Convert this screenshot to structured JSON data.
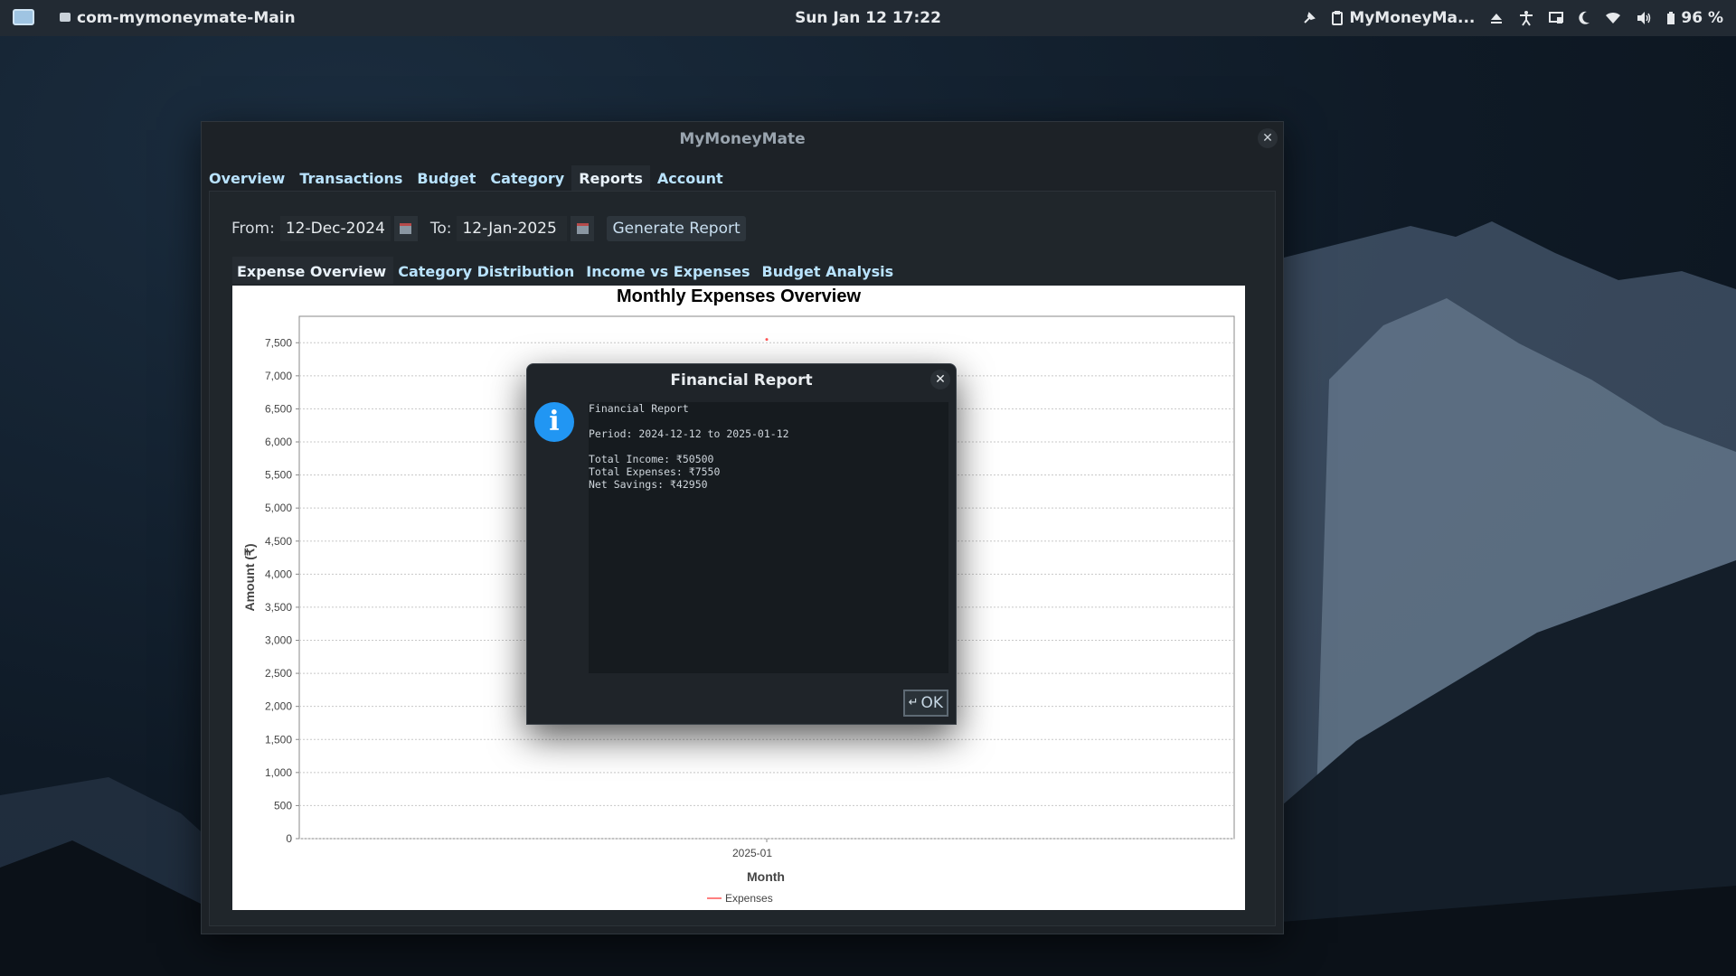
{
  "topbar": {
    "app_name": "com-mymoneymate-Main",
    "clock": "Sun Jan 12  17:22",
    "task_title": "MyMoneyMa...",
    "battery": "96 %"
  },
  "window": {
    "title": "MyMoneyMate",
    "close_glyph": "✕",
    "tabs": [
      "Overview",
      "Transactions",
      "Budget",
      "Category",
      "Reports",
      "Account"
    ],
    "active_tab": "Reports"
  },
  "report": {
    "from_label": "From:",
    "from_value": "12-Dec-2024",
    "to_label": "To:",
    "to_value": "12-Jan-2025",
    "generate_label": "Generate Report",
    "sub_tabs": [
      "Expense Overview",
      "Category Distribution",
      "Income vs Expenses",
      "Budget Analysis"
    ],
    "active_sub_tab": "Expense Overview"
  },
  "chart_data": {
    "type": "line",
    "title": "Monthly Expenses Overview",
    "xlabel": "Month",
    "ylabel": "Amount (₹)",
    "categories": [
      "2025-01"
    ],
    "series": [
      {
        "name": "Expenses",
        "values": [
          7550
        ],
        "color": "#ff5555"
      }
    ],
    "ylim": [
      0,
      7900
    ],
    "yticks": [
      0,
      500,
      1000,
      1500,
      2000,
      2500,
      3000,
      3500,
      4000,
      4500,
      5000,
      5500,
      6000,
      6500,
      7000,
      7500
    ],
    "ytick_labels": [
      "0",
      "500",
      "1,000",
      "1,500",
      "2,000",
      "2,500",
      "3,000",
      "3,500",
      "4,000",
      "4,500",
      "5,000",
      "5,500",
      "6,000",
      "6,500",
      "7,000",
      "7,500"
    ],
    "grid": true,
    "legend": "bottom"
  },
  "dialog": {
    "title": "Financial Report",
    "close_glyph": "✕",
    "icon_glyph": "i",
    "lines": [
      "Financial Report",
      "",
      "Period: 2024-12-12 to 2025-01-12",
      "",
      "Total Income: ₹50500",
      "Total Expenses: ₹7550",
      "Net Savings: ₹42950"
    ],
    "ok_label": "OK",
    "ok_icon": "↵"
  },
  "colors": {
    "accent": "#2196f3",
    "tab_text": "#b9e3ff",
    "panel_bg": "#1d2227"
  }
}
